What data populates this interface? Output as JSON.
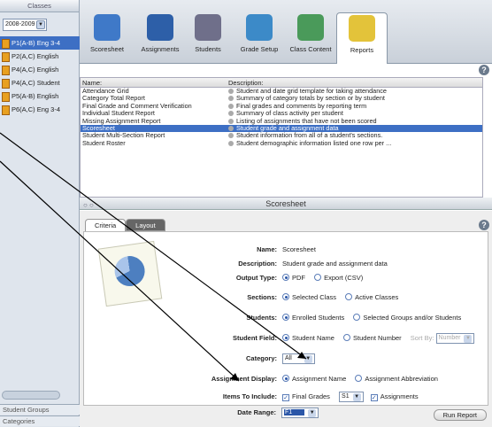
{
  "sidebar": {
    "header": "Classes",
    "year": "2008-2009",
    "classes": [
      {
        "label": "P1(A-B) Eng 3-4",
        "selected": true
      },
      {
        "label": "P2(A,C) English",
        "selected": false
      },
      {
        "label": "P4(A,C) English",
        "selected": false
      },
      {
        "label": "P4(A,C) Student",
        "selected": false
      },
      {
        "label": "P5(A-B) English",
        "selected": false
      },
      {
        "label": "P6(A,C) Eng 3-4",
        "selected": false
      }
    ],
    "footer1": "Student Groups",
    "footer2": "Categories"
  },
  "tabs": [
    {
      "label": "Scoresheet",
      "color": "#3f79c8"
    },
    {
      "label": "Assignments",
      "color": "#2d5fa8"
    },
    {
      "label": "Students",
      "color": "#6f6f8a"
    },
    {
      "label": "Grade Setup",
      "color": "#3c8ac8"
    },
    {
      "label": "Class Content",
      "color": "#4a9a5a"
    },
    {
      "label": "Reports",
      "color": "#e3c33a"
    }
  ],
  "report_list": {
    "col_name": "Name:",
    "col_desc": "Description:",
    "rows": [
      {
        "name": "Attendance Grid",
        "desc": "Student and date grid template for taking attendance"
      },
      {
        "name": "Category Total Report",
        "desc": "Summary of category totals by section or by student"
      },
      {
        "name": "Final Grade and Comment Verification",
        "desc": "Final grades and comments by reporting term"
      },
      {
        "name": "Individual Student Report",
        "desc": "Summary of class activity per student"
      },
      {
        "name": "Missing Assignment Report",
        "desc": "Listing of assignments that have not been scored"
      },
      {
        "name": "Scoresheet",
        "desc": "Student grade and assignment data",
        "selected": true
      },
      {
        "name": "Student Multi-Section Report",
        "desc": "Student information from all of a student's sections."
      },
      {
        "name": "Student Roster",
        "desc": "Student demographic information listed one row per ..."
      }
    ]
  },
  "scoresheet": {
    "title": "Scoresheet",
    "tab_criteria": "Criteria",
    "tab_layout": "Layout",
    "name_label": "Name:",
    "name_value": "Scoresheet",
    "desc_label": "Description:",
    "desc_value": "Student grade and assignment data",
    "output_label": "Output Type:",
    "output_pdf": "PDF",
    "output_csv": "Export (CSV)",
    "sections_label": "Sections:",
    "sections_selected": "Selected Class",
    "sections_active": "Active Classes",
    "students_label": "Students:",
    "students_enrolled": "Enrolled Students",
    "students_groups": "Selected Groups and/or Students",
    "field_label": "Student Field:",
    "field_name": "Student Name",
    "field_number": "Student Number",
    "sortby_label": "Sort By:",
    "sortby_value": "Number",
    "category_label": "Category:",
    "category_value": "All",
    "assign_disp_label": "Assignment Display:",
    "assign_disp_name": "Assignment Name",
    "assign_disp_abbr": "Assignment Abbreviation",
    "items_label": "Items To Include:",
    "items_final": "Final Grades",
    "items_term": "S1",
    "items_assign": "Assignments",
    "date_label": "Date Range:",
    "date_value": "F1",
    "run_button": "Run Report"
  }
}
